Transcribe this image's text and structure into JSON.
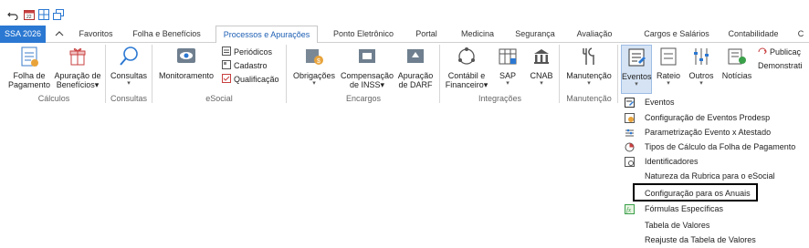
{
  "quick_access": {
    "icons": [
      "undo-icon",
      "calendar-icon",
      "grid-icon",
      "windows-icon"
    ]
  },
  "tabs": [
    {
      "label": "SSA 2026"
    },
    {
      "label": "Favoritos"
    },
    {
      "label": "Folha e Benefícios"
    },
    {
      "label": "Processos e Apurações"
    },
    {
      "label": "Ponto Eletrônico"
    },
    {
      "label": "Portal"
    },
    {
      "label": "Medicina"
    },
    {
      "label": "Segurança"
    },
    {
      "label": "Avaliação"
    },
    {
      "label": "Cargos e Salários"
    },
    {
      "label": "Contabilidade"
    },
    {
      "label": "C"
    }
  ],
  "active_tab": "Processos e Apurações",
  "ribbon": {
    "folha_label1": "Folha de",
    "folha_label2": "Pagamento",
    "apuracao_label1": "Apuração de",
    "apuracao_label2": "Benefícios",
    "consultas_label": "Consultas",
    "monitoramento_label": "Monitoramento",
    "periodicos_label": "Periódicos",
    "cadastro_label": "Cadastro",
    "qualificacao_label": "Qualificação",
    "obrigacoes_label": "Obrigações",
    "compensacao_label1": "Compensação",
    "compensacao_label2": "de INSS",
    "apuracao_darf_label1": "Apuração",
    "apuracao_darf_label2": "de DARF",
    "contabil_label1": "Contábil e",
    "contabil_label2": "Financeiro",
    "sap_label": "SAP",
    "cnab_label": "CNAB",
    "manutencao_label": "Manutenção",
    "eventos_label": "Eventos",
    "rateio_label": "Rateio",
    "outros_label": "Outros",
    "noticias_label": "Notícias",
    "publicacao_label": "Publicaç",
    "demonstrativo_label": "Demonstrati",
    "groups": {
      "calculos": "Cálculos",
      "consultas": "Consultas",
      "esocial": "eSocial",
      "encargos": "Encargos",
      "integracoes": "Integrações",
      "manutencao": "Manutenção"
    },
    "dropdown_marker": "▾"
  },
  "menu": {
    "items": [
      {
        "label": "Eventos",
        "icon": "events-icon"
      },
      {
        "label": "Configuração de Eventos Prodesp",
        "icon": "config-events-icon"
      },
      {
        "label": "Parametrização Evento x Atestado",
        "icon": "parameter-icon"
      },
      {
        "label": "Tipos de Cálculo da Folha de Pagamento",
        "icon": "calc-types-icon"
      },
      {
        "label": "Identificadores",
        "icon": "identifiers-icon"
      },
      {
        "label": "Natureza da Rubrica para o eSocial",
        "icon": ""
      },
      {
        "label": "Configuração para os Anuais",
        "icon": ""
      },
      {
        "label": "Fórmulas Específicas",
        "icon": "formula-icon"
      },
      {
        "label": "Tabela de Valores",
        "icon": ""
      },
      {
        "label": "Reajuste da Tabela de Valores",
        "icon": ""
      }
    ],
    "highlighted_item": "Configuração para os Anuais"
  },
  "colors": {
    "accent": "#2b78d2",
    "active_tab_text": "#1d5fb4",
    "pressed_bg": "#d5e3f4"
  }
}
